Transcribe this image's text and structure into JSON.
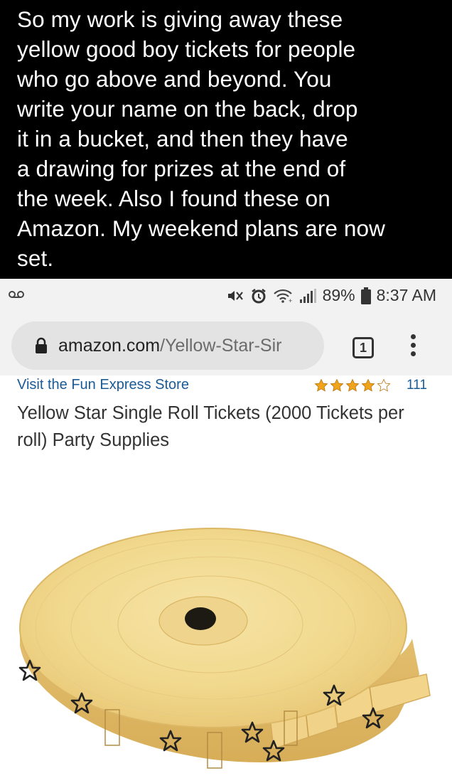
{
  "caption": {
    "lines": [
      "So my work is giving away these",
      "yellow good boy tickets for people",
      "who go above and beyond. You",
      "write your name on the back, drop",
      "it in a bucket, and then they have",
      "a drawing for prizes at the end of",
      "the week. Also I found these on",
      "Amazon. My weekend plans are now",
      "set."
    ]
  },
  "status_bar": {
    "left_icon": "voicemail-icon",
    "icons": [
      "mute-vibrate-icon",
      "alarm-icon",
      "wifi-icon",
      "signal-icon",
      "battery-icon"
    ],
    "battery": "89%",
    "time": "8:37 AM"
  },
  "browser": {
    "url_domain": "amazon.com",
    "url_path": "/Yellow-Star-Sir",
    "tab_count": "1",
    "lock_icon": "lock-icon",
    "menu_icon": "more-vert-icon"
  },
  "product": {
    "store_link": "Visit the Fun Express Store",
    "rating_icon": "star-rating-icon",
    "rating": 4.5,
    "review_count": "111",
    "title": "Yellow Star Single Roll Tickets (2000 Tickets per roll) Party Supplies",
    "image": "ticket-roll-image"
  },
  "colors": {
    "caption_bg": "#000000",
    "chrome_bg": "#f2f2f2",
    "link": "#1a5a96",
    "star": "#f0a41c",
    "ticket": "#f3d68a"
  }
}
